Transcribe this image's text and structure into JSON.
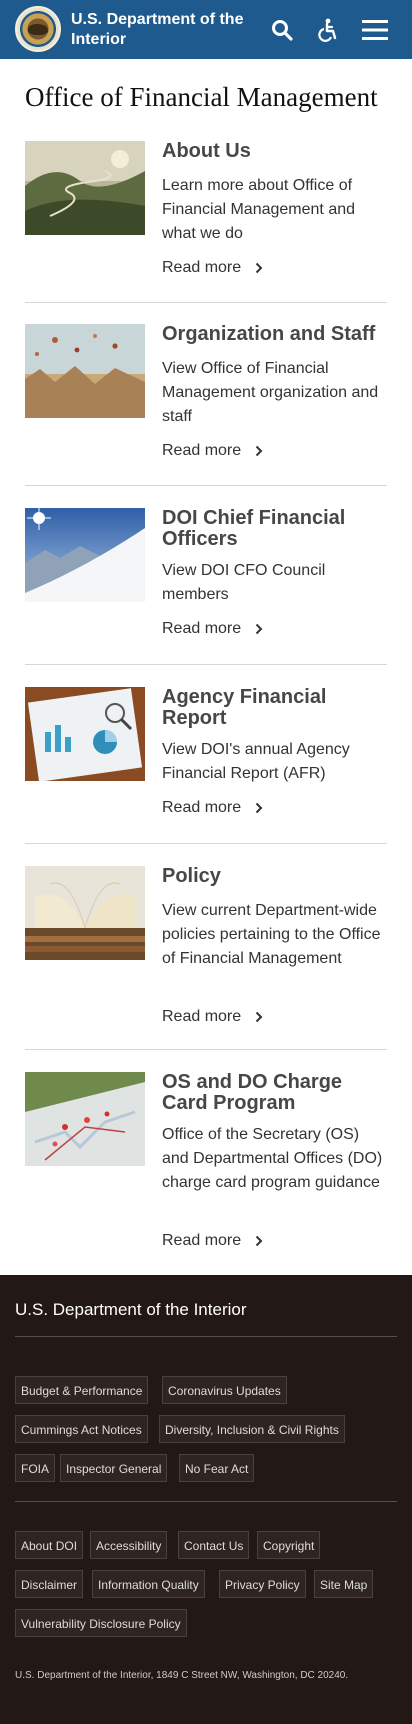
{
  "header": {
    "agency_name": "U.S. Department of the Interior",
    "logo_icon": "doi-seal-icon",
    "search_icon": "search-icon",
    "accessibility_icon": "accessibility-icon",
    "menu_icon": "hamburger-menu-icon",
    "background": "#1e5a8e"
  },
  "page": {
    "title": "Office of Financial Management"
  },
  "cards": [
    {
      "title": "About Us",
      "description": "Learn more about Office of Financial Management and what we do",
      "read_more": "Read more",
      "image": "misty-mountain-road-photo"
    },
    {
      "title": "Organization and Staff",
      "description": "View Office of Financial Management organization and staff",
      "read_more": "Read more",
      "image": "hot-air-balloons-photo"
    },
    {
      "title": "DOI Chief Financial Officers",
      "description": "View DOI CFO Council members",
      "read_more": "Read more",
      "image": "snowy-mountain-sun-photo"
    },
    {
      "title": "Agency Financial Report",
      "description": "View DOI's annual Agency Financial Report (AFR)",
      "read_more": "Read more",
      "image": "financial-charts-photo"
    },
    {
      "title": "Policy",
      "description": "View current Department-wide policies pertaining to the Office of Financial Management",
      "read_more": "Read more",
      "image": "open-book-photo"
    },
    {
      "title": "OS and DO Charge Card Program",
      "description": "Office of the Secretary (OS) and Departmental Offices (DO) charge card program guidance",
      "read_more": "Read more",
      "image": "map-with-pins-photo"
    }
  ],
  "footer": {
    "title": "U.S. Department of the Interior",
    "links_primary": [
      "Budget & Performance",
      "Coronavirus Updates",
      "Cummings Act Notices",
      "Diversity, Inclusion & Civil Rights",
      "FOIA",
      "Inspector General",
      "No Fear Act"
    ],
    "links_secondary": [
      "About DOI",
      "Accessibility",
      "Contact Us",
      "Copyright",
      "Disclaimer",
      "Information Quality",
      "Privacy Policy",
      "Site Map",
      "Vulnerability Disclosure Policy"
    ],
    "address": "U.S. Department of the Interior, 1849 C Street NW, Washington, DC 20240.",
    "background": "#221816"
  }
}
